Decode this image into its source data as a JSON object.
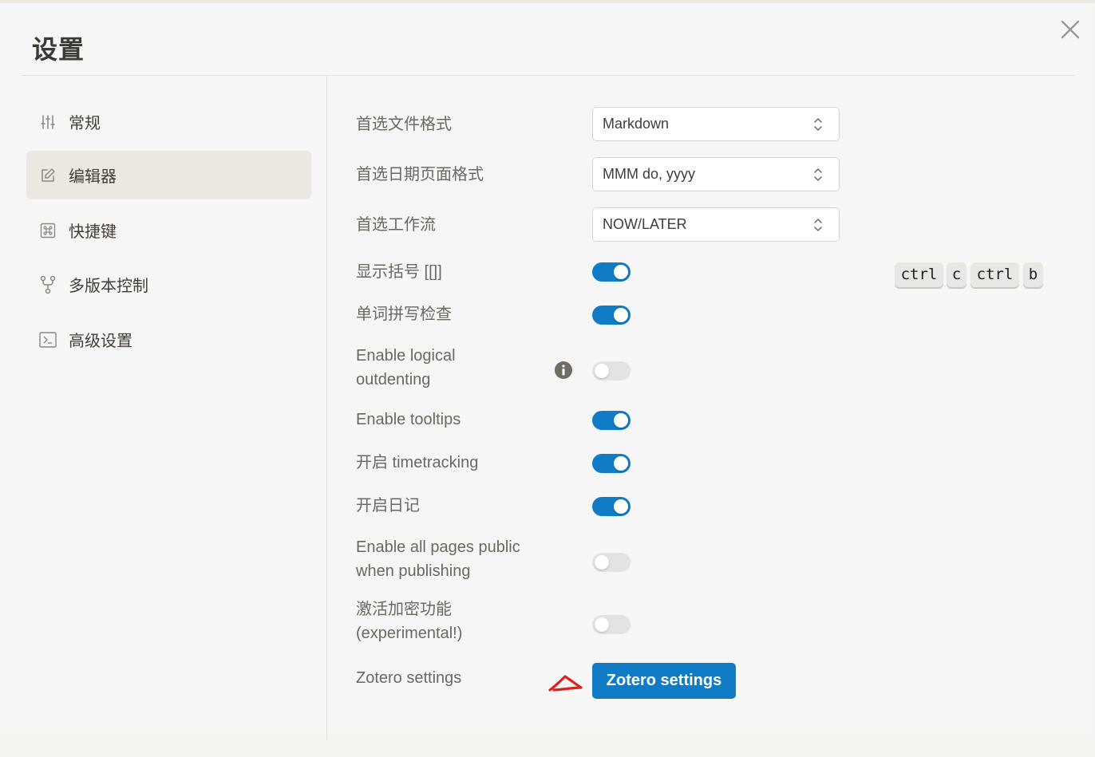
{
  "dialog": {
    "title": "设置",
    "close_icon": "close-icon"
  },
  "sidebar": {
    "items": [
      {
        "label": "常规",
        "icon": "sliders-icon",
        "active": false
      },
      {
        "label": "编辑器",
        "icon": "edit-icon",
        "active": true
      },
      {
        "label": "快捷键",
        "icon": "command-key-icon",
        "active": false
      },
      {
        "label": "多版本控制",
        "icon": "git-branch-icon",
        "active": false
      },
      {
        "label": "高级设置",
        "icon": "terminal-icon",
        "active": false
      }
    ]
  },
  "editor": {
    "file_format": {
      "label": "首选文件格式",
      "value": "Markdown"
    },
    "date_format": {
      "label": "首选日期页面格式",
      "value": "MMM do, yyyy"
    },
    "workflow": {
      "label": "首选工作流",
      "value": "NOW/LATER"
    },
    "show_brackets": {
      "label": "显示括号 [[]]",
      "on": true,
      "shortcut": [
        "ctrl",
        "c",
        "ctrl",
        "b"
      ]
    },
    "spell_check": {
      "label": "单词拼写检查",
      "on": true
    },
    "logical_outdenting": {
      "label_line1": "Enable logical",
      "label_line2": "outdenting",
      "on": false
    },
    "tooltips": {
      "label": "Enable tooltips",
      "on": true
    },
    "timetracking": {
      "label": "开启 timetracking",
      "on": true
    },
    "journals": {
      "label": "开启日记",
      "on": true
    },
    "public_pages": {
      "label_line1": "Enable all pages public",
      "label_line2": "when publishing",
      "on": false
    },
    "encryption": {
      "label_line1": "激活加密功能",
      "label_line2": "(experimental!)",
      "on": false
    },
    "zotero": {
      "label": "Zotero settings",
      "button_label": "Zotero settings"
    }
  },
  "colors": {
    "accent": "#0f7cc5",
    "toggle_off": "#e3e3e3",
    "annotation": "#e0201b"
  }
}
